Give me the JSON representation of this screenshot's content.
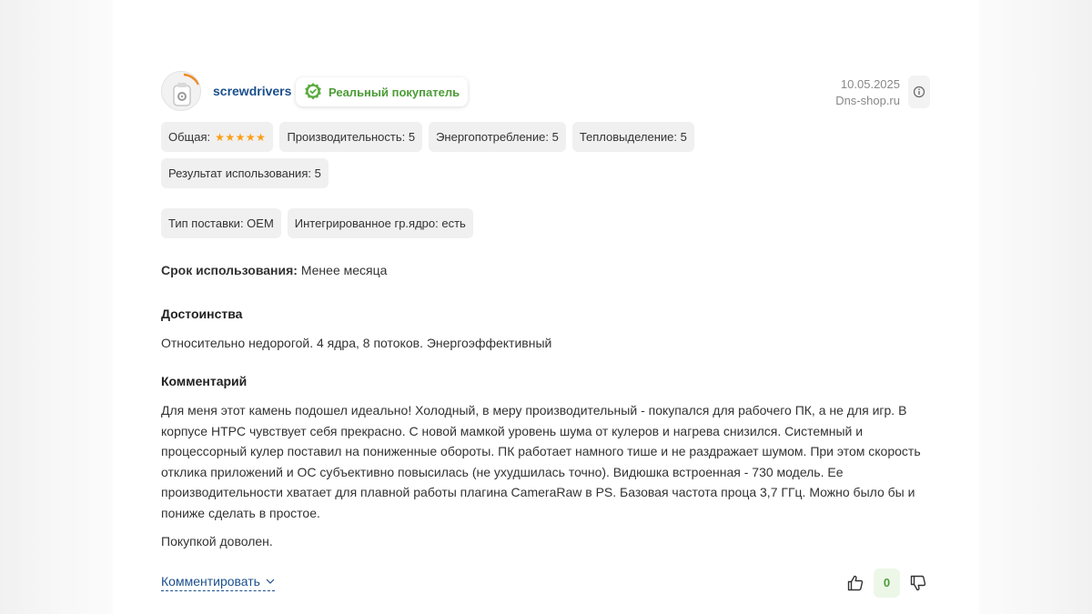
{
  "review": {
    "author": "screwdrivers",
    "badge": "Реальный покупатель",
    "date": "10.05.2025",
    "source": "Dns-shop.ru",
    "ratings": [
      {
        "label": "Общая:",
        "stars": 5,
        "stars_text": "★★★★★"
      },
      {
        "label": "Производительность: 5"
      },
      {
        "label": "Энергопотребление: 5"
      },
      {
        "label": "Тепловыделение: 5"
      },
      {
        "label": "Результат использования: 5"
      }
    ],
    "specs": [
      {
        "label": "Тип поставки: OEM"
      },
      {
        "label": "Интегрированное гр.ядро: есть"
      }
    ],
    "usage_label": "Срок использования:",
    "usage_value": "Менее месяца",
    "advantages_title": "Достоинства",
    "advantages_text": "Относительно недорогой. 4 ядра, 8 потоков. Энергоэффективный",
    "comment_title": "Комментарий",
    "comment_text": "Для меня этот камень подошел идеально! Холодный, в меру производительный - покупался для рабочего ПК, а не для игр. В корпусе HTPC чувствует себя прекрасно. С новой мамкой уровень шума от кулеров и нагрева снизился. Системный и процессорный кулер поставил на пониженные обороты. ПК работает намного тише и не раздражает шумом. При этом скорость отклика приложений и ОС субъективно повысилась (не ухудшилась точно). Видюшка встроенная - 730 модель. Ее производительности хватает для плавной работы плагина CameraRaw в PS. Базовая частота проца 3,7 ГГц. Можно было бы и пониже сделать в простое.",
    "comment_text_2": "Покупкой доволен.",
    "comment_action": "Комментировать",
    "vote_count": "0"
  },
  "colors": {
    "link": "#1b4f8c",
    "badge_green": "#4c9c37",
    "star": "#fb9f15",
    "chip_bg": "#f0f0f0",
    "vote_bg": "#edf7e8"
  },
  "icons": {
    "avatar": "avatar-icon",
    "verified": "verified-check-icon",
    "info": "info-icon",
    "chevron": "chevron-down-icon",
    "like": "thumb-up-icon",
    "dislike": "thumb-down-icon"
  }
}
